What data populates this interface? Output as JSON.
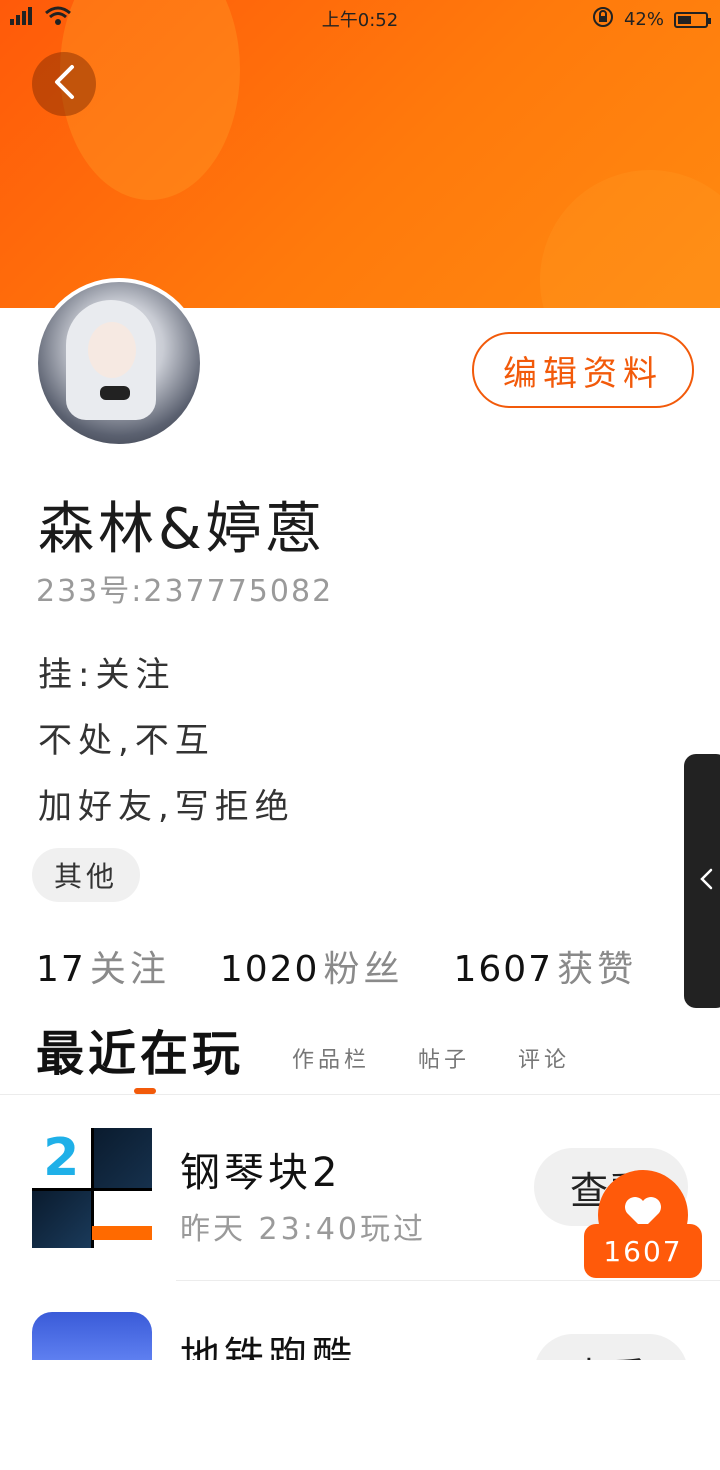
{
  "status_bar": {
    "time": "上午0:52",
    "battery_percent": "42%"
  },
  "profile": {
    "edit_label": "编辑资料",
    "name": "森林&婷蒽",
    "uid": "233号:237775082",
    "bio_lines": [
      "挂:关注",
      "不处,不互",
      "加好友,写拒绝"
    ],
    "tag": "其他"
  },
  "stats": [
    {
      "num": "17",
      "label": "关注"
    },
    {
      "num": "1020",
      "label": "粉丝"
    },
    {
      "num": "1607",
      "label": "获赞"
    }
  ],
  "tabs": {
    "active": "最近在玩",
    "others": [
      "作品栏",
      "帖子",
      "评论"
    ]
  },
  "games": [
    {
      "title": "钢琴块2",
      "subtitle": "昨天 23:40玩过",
      "action": "查看",
      "icon_name": "piano-tiles-2-icon"
    },
    {
      "title": "地铁跑酷",
      "subtitle": "",
      "action": "查看",
      "icon_name": "subway-surfers-icon"
    }
  ],
  "like_badge": {
    "count": "1607"
  },
  "colors": {
    "accent": "#f25a0a",
    "header_gradient_start": "#ff5a0a",
    "header_gradient_end": "#ff8a10"
  }
}
